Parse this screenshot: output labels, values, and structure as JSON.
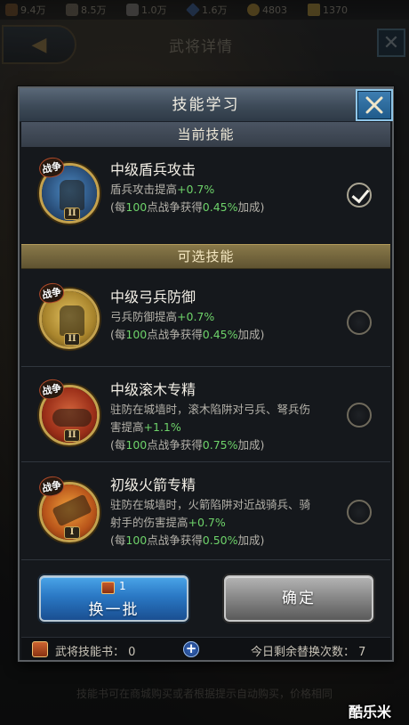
{
  "background": {
    "resources": [
      {
        "icon": "wood-icon",
        "value": "9.4万"
      },
      {
        "icon": "food-icon",
        "value": "8.5万"
      },
      {
        "icon": "iron-icon",
        "value": "1.0万"
      },
      {
        "icon": "gem-icon",
        "value": "1.6万"
      },
      {
        "icon": "coin-icon",
        "value": "4803"
      },
      {
        "icon": "gold-icon",
        "value": "1370"
      }
    ],
    "page_title": "武将详情",
    "hint_text": "技能书可在商城购买或者根据提示自动购买，价格相同"
  },
  "watermark": "酷乐米",
  "dialog": {
    "title": "技能学习",
    "current_header": "当前技能",
    "optional_header": "可选技能",
    "current_skill": {
      "tag": "战争",
      "rank": "II",
      "name": "中级盾兵攻击",
      "desc_prefix": "盾兵攻击提高",
      "desc_value": "+0.7%",
      "bonus_a": "(每",
      "bonus_b": "100",
      "bonus_c": "点战争获得",
      "bonus_d": "0.45%",
      "bonus_e": "加成)",
      "selected": true,
      "icon": "shield-soldier-icon"
    },
    "options": [
      {
        "tag": "战争",
        "rank": "II",
        "name": "中级弓兵防御",
        "line1_prefix": "弓兵防御提高",
        "line1_value": "+0.7%",
        "bonus_b": "100",
        "bonus_d": "0.45%",
        "icon": "archer-defense-icon",
        "selected": false
      },
      {
        "tag": "战争",
        "rank": "II",
        "name": "中级滚木专精",
        "line1": "驻防在城墙时，滚木陷阱对弓兵、弩兵伤",
        "line2_prefix": "害提高",
        "line2_value": "+1.1%",
        "bonus_b": "100",
        "bonus_d": "0.75%",
        "icon": "rolling-log-icon",
        "selected": false
      },
      {
        "tag": "战争",
        "rank": "I",
        "name": "初级火箭专精",
        "line1": "驻防在城墙时，火箭陷阱对近战骑兵、骑",
        "line2_prefix": "射手的伤害提高",
        "line2_value": "+0.7%",
        "bonus_b": "100",
        "bonus_d": "0.50%",
        "icon": "fire-arrow-icon",
        "selected": false
      }
    ],
    "bonus_a": "(每",
    "bonus_c": "点战争获得",
    "bonus_e": "加成)",
    "swap_button": {
      "count": "1",
      "label": "换一批"
    },
    "confirm_button": {
      "label": "确定"
    },
    "footer": {
      "book_label": "武将技能书：",
      "book_count": "0",
      "add_symbol": "+",
      "remaining_label": "今日剩余替换次数：",
      "remaining_count": "7"
    }
  },
  "colors": {
    "highlight_green": "#6ed36a",
    "swap_blue": "#2a78c4",
    "optional_gold": "#8a7a4a"
  }
}
